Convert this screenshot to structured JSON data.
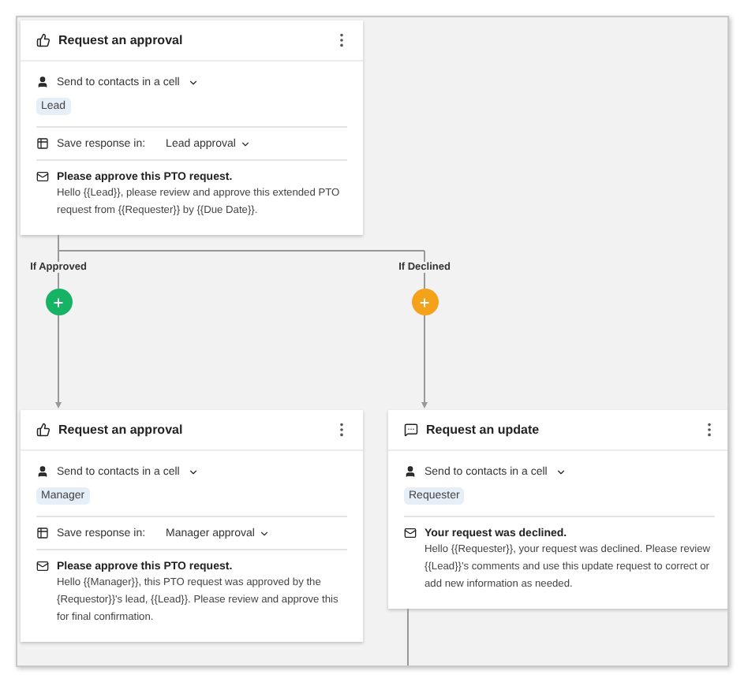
{
  "cards": [
    {
      "kind": "approval",
      "title": "Request an approval",
      "recipient": {
        "label": "Send to contacts in a cell",
        "tag": "Lead"
      },
      "save_response": {
        "label": "Save response in:",
        "value": "Lead approval"
      },
      "message": {
        "subject": "Please approve this PTO request.",
        "body": "Hello {{Lead}}, please review and approve this extended PTO request from {{Requester}} by {{Due Date}}."
      }
    },
    {
      "kind": "approval",
      "title": "Request an approval",
      "recipient": {
        "label": "Send to contacts in a cell",
        "tag": "Manager"
      },
      "save_response": {
        "label": "Save response in:",
        "value": "Manager approval"
      },
      "message": {
        "subject": "Please approve this PTO request.",
        "body": "Hello {{Manager}}, this PTO request was approved by the {Requestor}}'s lead, {{Lead}}. Please review and approve this for final confirmation."
      }
    },
    {
      "kind": "update",
      "title": "Request an update",
      "recipient": {
        "label": "Send to contacts in a cell",
        "tag": "Requester"
      },
      "message": {
        "subject": "Your request was declined.",
        "body": "Hello {{Requester}}, your request was declined. Please review {{Lead}}'s comments and use this update request to correct or add new information as needed."
      }
    }
  ],
  "branches": [
    {
      "label": "If Approved",
      "color": "#16b364"
    },
    {
      "label": "If Declined",
      "color": "#f5a21b"
    }
  ]
}
